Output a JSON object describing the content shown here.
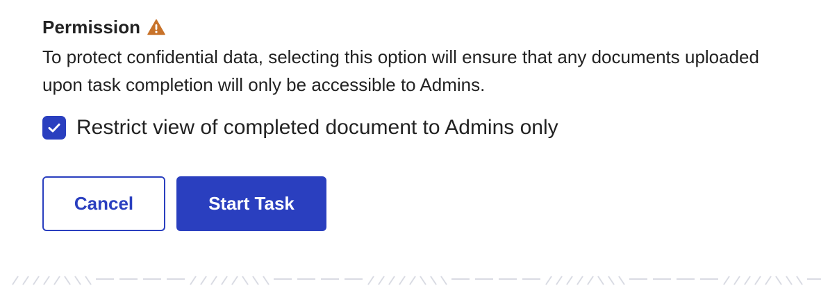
{
  "permission": {
    "heading": "Permission",
    "warning_icon": "warning-triangle-icon",
    "warning_color": "#c8732a",
    "description": "To protect confidential data, selecting this option will ensure that any documents uploaded upon task completion will only be accessible to Admins."
  },
  "restrict_option": {
    "label": "Restrict view of completed document to Admins only",
    "checked": true
  },
  "actions": {
    "cancel_label": "Cancel",
    "start_label": "Start Task"
  },
  "colors": {
    "primary": "#2a3fbf",
    "text": "#222222",
    "background": "#ffffff",
    "pattern": "#d9dbe3"
  }
}
